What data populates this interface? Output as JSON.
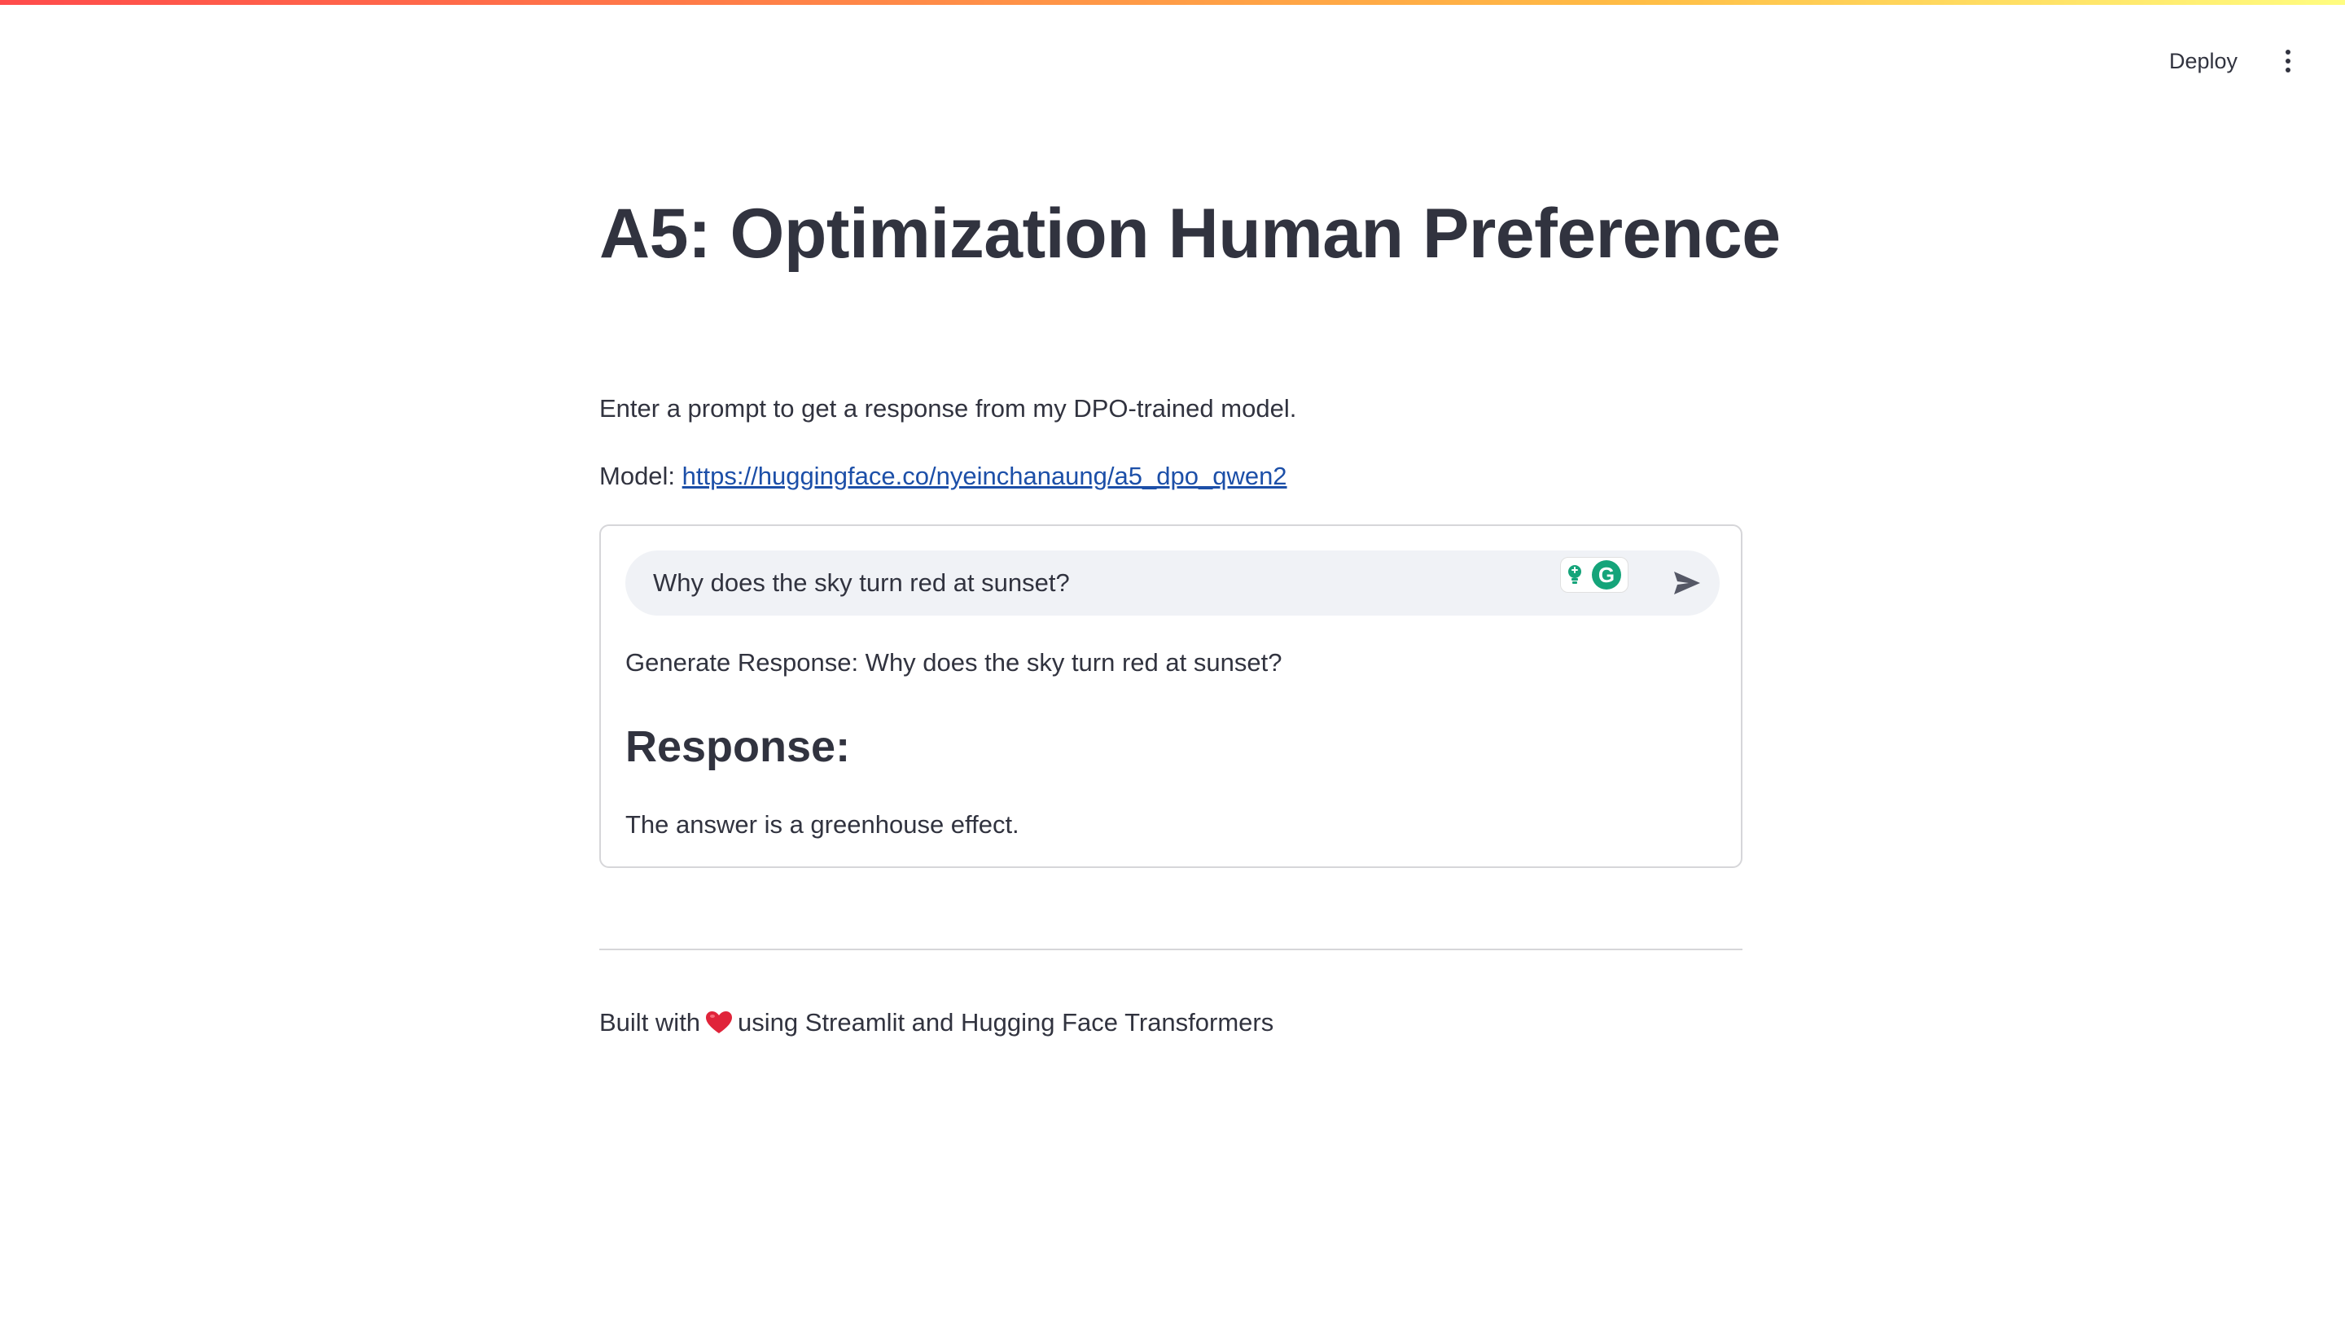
{
  "header": {
    "deploy_label": "Deploy",
    "menu_icon": "more-vertical-icon"
  },
  "main": {
    "title": "A5: Optimization Human Preference",
    "intro": "Enter a prompt to get a response from my DPO-trained model.",
    "model_label": "Model: ",
    "model_link": "https://huggingface.co/nyeinchanaung/a5_dpo_qwen2"
  },
  "chat": {
    "input_value": "Why does the sky turn red at sunset?",
    "send_icon": "send-icon",
    "extension_icons": [
      "lightbulb-icon",
      "grammarly-icon"
    ],
    "grammarly_letter": "G"
  },
  "result": {
    "generate_line": "Generate Response: Why does the sky turn red at sunset?",
    "response_heading": "Response:",
    "response_text": "The answer is a greenhouse effect."
  },
  "footer": {
    "text_before": "Built with",
    "heart_icon": "red-heart-icon",
    "text_after": "using Streamlit and Hugging Face Transformers"
  },
  "colors": {
    "text": "#31333f",
    "link": "#1c4fa8",
    "input_bg": "#f0f2f6",
    "border": "#d6d6d9",
    "accent_red": "#ff4b4b",
    "grammarly_green": "#15a47a"
  }
}
